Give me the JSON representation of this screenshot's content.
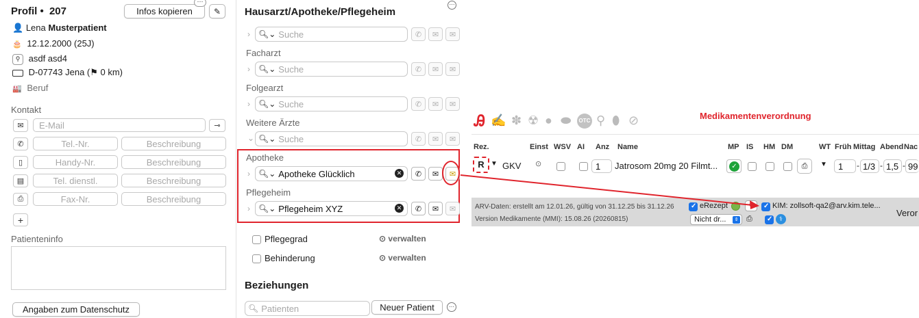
{
  "profile": {
    "title": "Profil •",
    "number": "207",
    "copy_button": "Infos kopieren",
    "first_name": "Lena",
    "last_name": "Musterpatient",
    "birthdate": "12.12.2000 (25J)",
    "street": "asdf asd4",
    "city": "D-07743 Jena (⚑ 0 km)",
    "job_placeholder": "Beruf"
  },
  "kontakt": {
    "label": "Kontakt",
    "email_placeholder": "E-Mail",
    "phone_placeholder": "Tel.-Nr.",
    "mobile_placeholder": "Handy-Nr.",
    "office_placeholder": "Tel. dienstl.",
    "fax_placeholder": "Fax-Nr.",
    "desc_placeholder": "Beschreibung"
  },
  "patient_info": {
    "label": "Patienteninfo"
  },
  "privacy_button": "Angaben zum Datenschutz",
  "doctors": {
    "title": "Hausarzt/Apotheke/Pflegeheim",
    "search_placeholder": "Suche",
    "facharzt": "Facharzt",
    "folgearzt": "Folgearzt",
    "weitere": "Weitere Ärzte",
    "apotheke_label": "Apotheke",
    "apotheke_value": "Apotheke Glücklich",
    "pflegeheim_label": "Pflegeheim",
    "pflegeheim_value": "Pflegeheim XYZ"
  },
  "care": {
    "pflegegrad": "Pflegegrad",
    "behinderung": "Behinderung",
    "manage": "verwalten"
  },
  "relations": {
    "title": "Beziehungen",
    "placeholder": "Patienten",
    "new_button": "Neuer Patient"
  },
  "med": {
    "title": "Medikamentenverordnung",
    "headers": [
      "Rez.",
      "Einst",
      "WSV",
      "AI",
      "Anz",
      "Name",
      "MP",
      "IS",
      "HM",
      "DM",
      "WT",
      "Früh",
      "Mittag",
      "Abend",
      "Nac"
    ],
    "insurance": "GKV",
    "count": "1",
    "drug_name": "Jatrosom 20mg 20 Filmt...",
    "dose_frueh": "1",
    "dose_mittag": "1/3",
    "dose_abend": "1,5",
    "dose_nacht": "99",
    "arv_line": "ARV-Daten: erstellt am 12.01.26, gültig von 31.12.25 bis 31.12.26",
    "version_line": "Version Medikamente (MMI):  15.08.26 (20260815)",
    "erezept": "eRezept",
    "kim": "KIM: zollsoft-qa2@arv.kim.tele...",
    "select_value": "Nicht dr...",
    "verord": "Veror"
  },
  "colors": {
    "accent_red": "#e0242c",
    "checkbox_blue": "#1a73e8",
    "title_red": "#e0242c"
  }
}
